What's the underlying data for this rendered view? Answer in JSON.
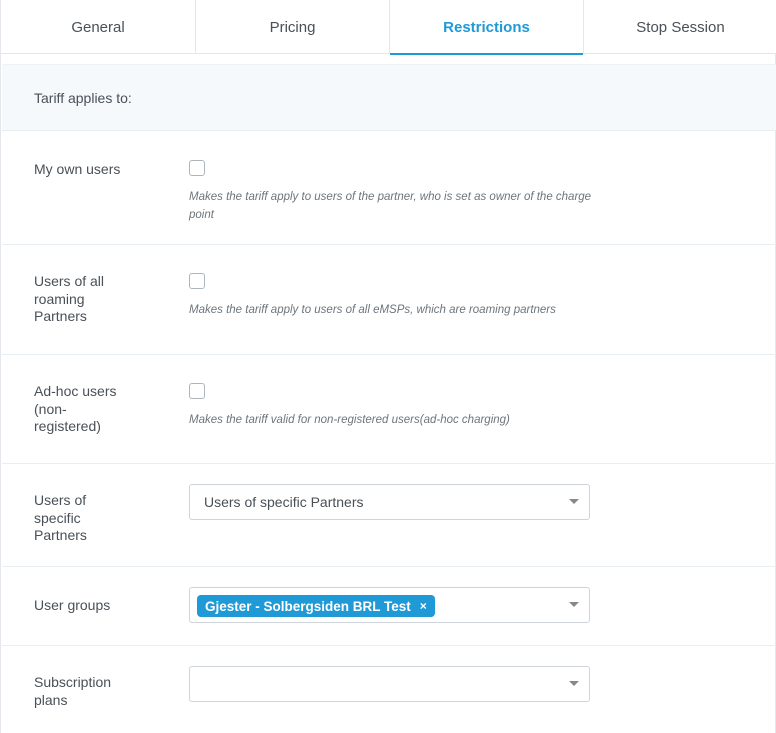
{
  "tabs": [
    {
      "label": "General",
      "active": false
    },
    {
      "label": "Pricing",
      "active": false
    },
    {
      "label": "Restrictions",
      "active": true
    },
    {
      "label": "Stop Session",
      "active": false
    }
  ],
  "section": {
    "title": "Tariff applies to:"
  },
  "rows": {
    "own_users": {
      "label": "My own users",
      "checked": false,
      "help": "Makes the tariff apply to users of the partner, who is set as owner of the charge point"
    },
    "roaming_partners": {
      "label": "Users of all roaming Partners",
      "checked": false,
      "help": "Makes the tariff apply to users of all eMSPs, which are roaming partners"
    },
    "adhoc": {
      "label": "Ad-hoc users (non-registered)",
      "checked": false,
      "help": "Makes the tariff valid for non-registered users(ad-hoc charging)"
    },
    "specific_partners": {
      "label": "Users of specific Partners",
      "selected": "Users of specific Partners"
    },
    "user_groups": {
      "label": "User groups",
      "chip": "Gjester - Solbergsiden BRL Test",
      "chip_remove": "×"
    },
    "subscription_plans": {
      "label": "Subscription plans",
      "selected": ""
    }
  },
  "colors": {
    "accent": "#1f9ad6",
    "section_bg": "#f5f9fc"
  },
  "icons": {
    "dropdown": "chevron-down-icon",
    "remove": "close-icon"
  }
}
